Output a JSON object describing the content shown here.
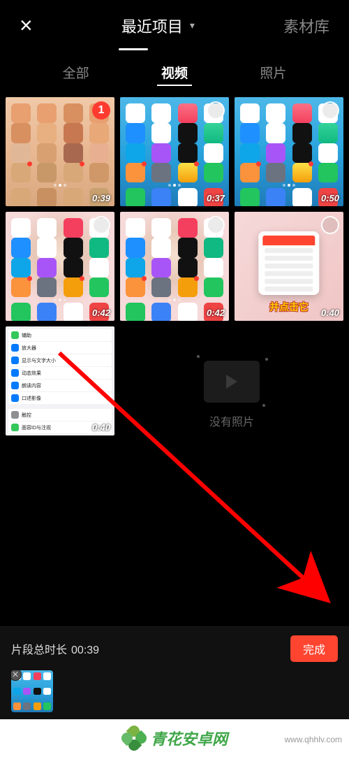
{
  "header": {
    "close_icon": "×",
    "dropdown_label": "最近项目",
    "library_label": "素材库"
  },
  "tabs": {
    "all": "全部",
    "video": "视频",
    "photo": "照片"
  },
  "thumbs": [
    {
      "duration": "0:39",
      "selected_badge": "1",
      "style": "tint"
    },
    {
      "duration": "0:37",
      "style": "blue"
    },
    {
      "duration": "0:50",
      "style": "blue"
    },
    {
      "duration": "0:42",
      "style": "baby"
    },
    {
      "duration": "0:42",
      "style": "baby"
    },
    {
      "duration": "0:40",
      "style": "pink",
      "overlay_text": "并点击它"
    },
    {
      "duration": "0:40",
      "style": "settings"
    }
  ],
  "settings_items": [
    {
      "color": "#34c759",
      "label": "辅助"
    },
    {
      "color": "#007aff",
      "label": "放大器"
    },
    {
      "color": "#007aff",
      "label": "显示与文字大小"
    },
    {
      "color": "#007aff",
      "label": "动态效果"
    },
    {
      "color": "#007aff",
      "label": "朗读内容"
    },
    {
      "color": "#007aff",
      "label": "口述影像"
    },
    {
      "color": "#8e8e93",
      "label": "触控"
    },
    {
      "color": "#34c759",
      "label": "面容ID与注视"
    }
  ],
  "empty_state": "没有照片",
  "footer": {
    "total_label": "片段总时长",
    "total_value": "00:39",
    "done_label": "完成"
  },
  "watermark": {
    "text": "青花安卓网",
    "url": "www.qhhlv.com"
  }
}
